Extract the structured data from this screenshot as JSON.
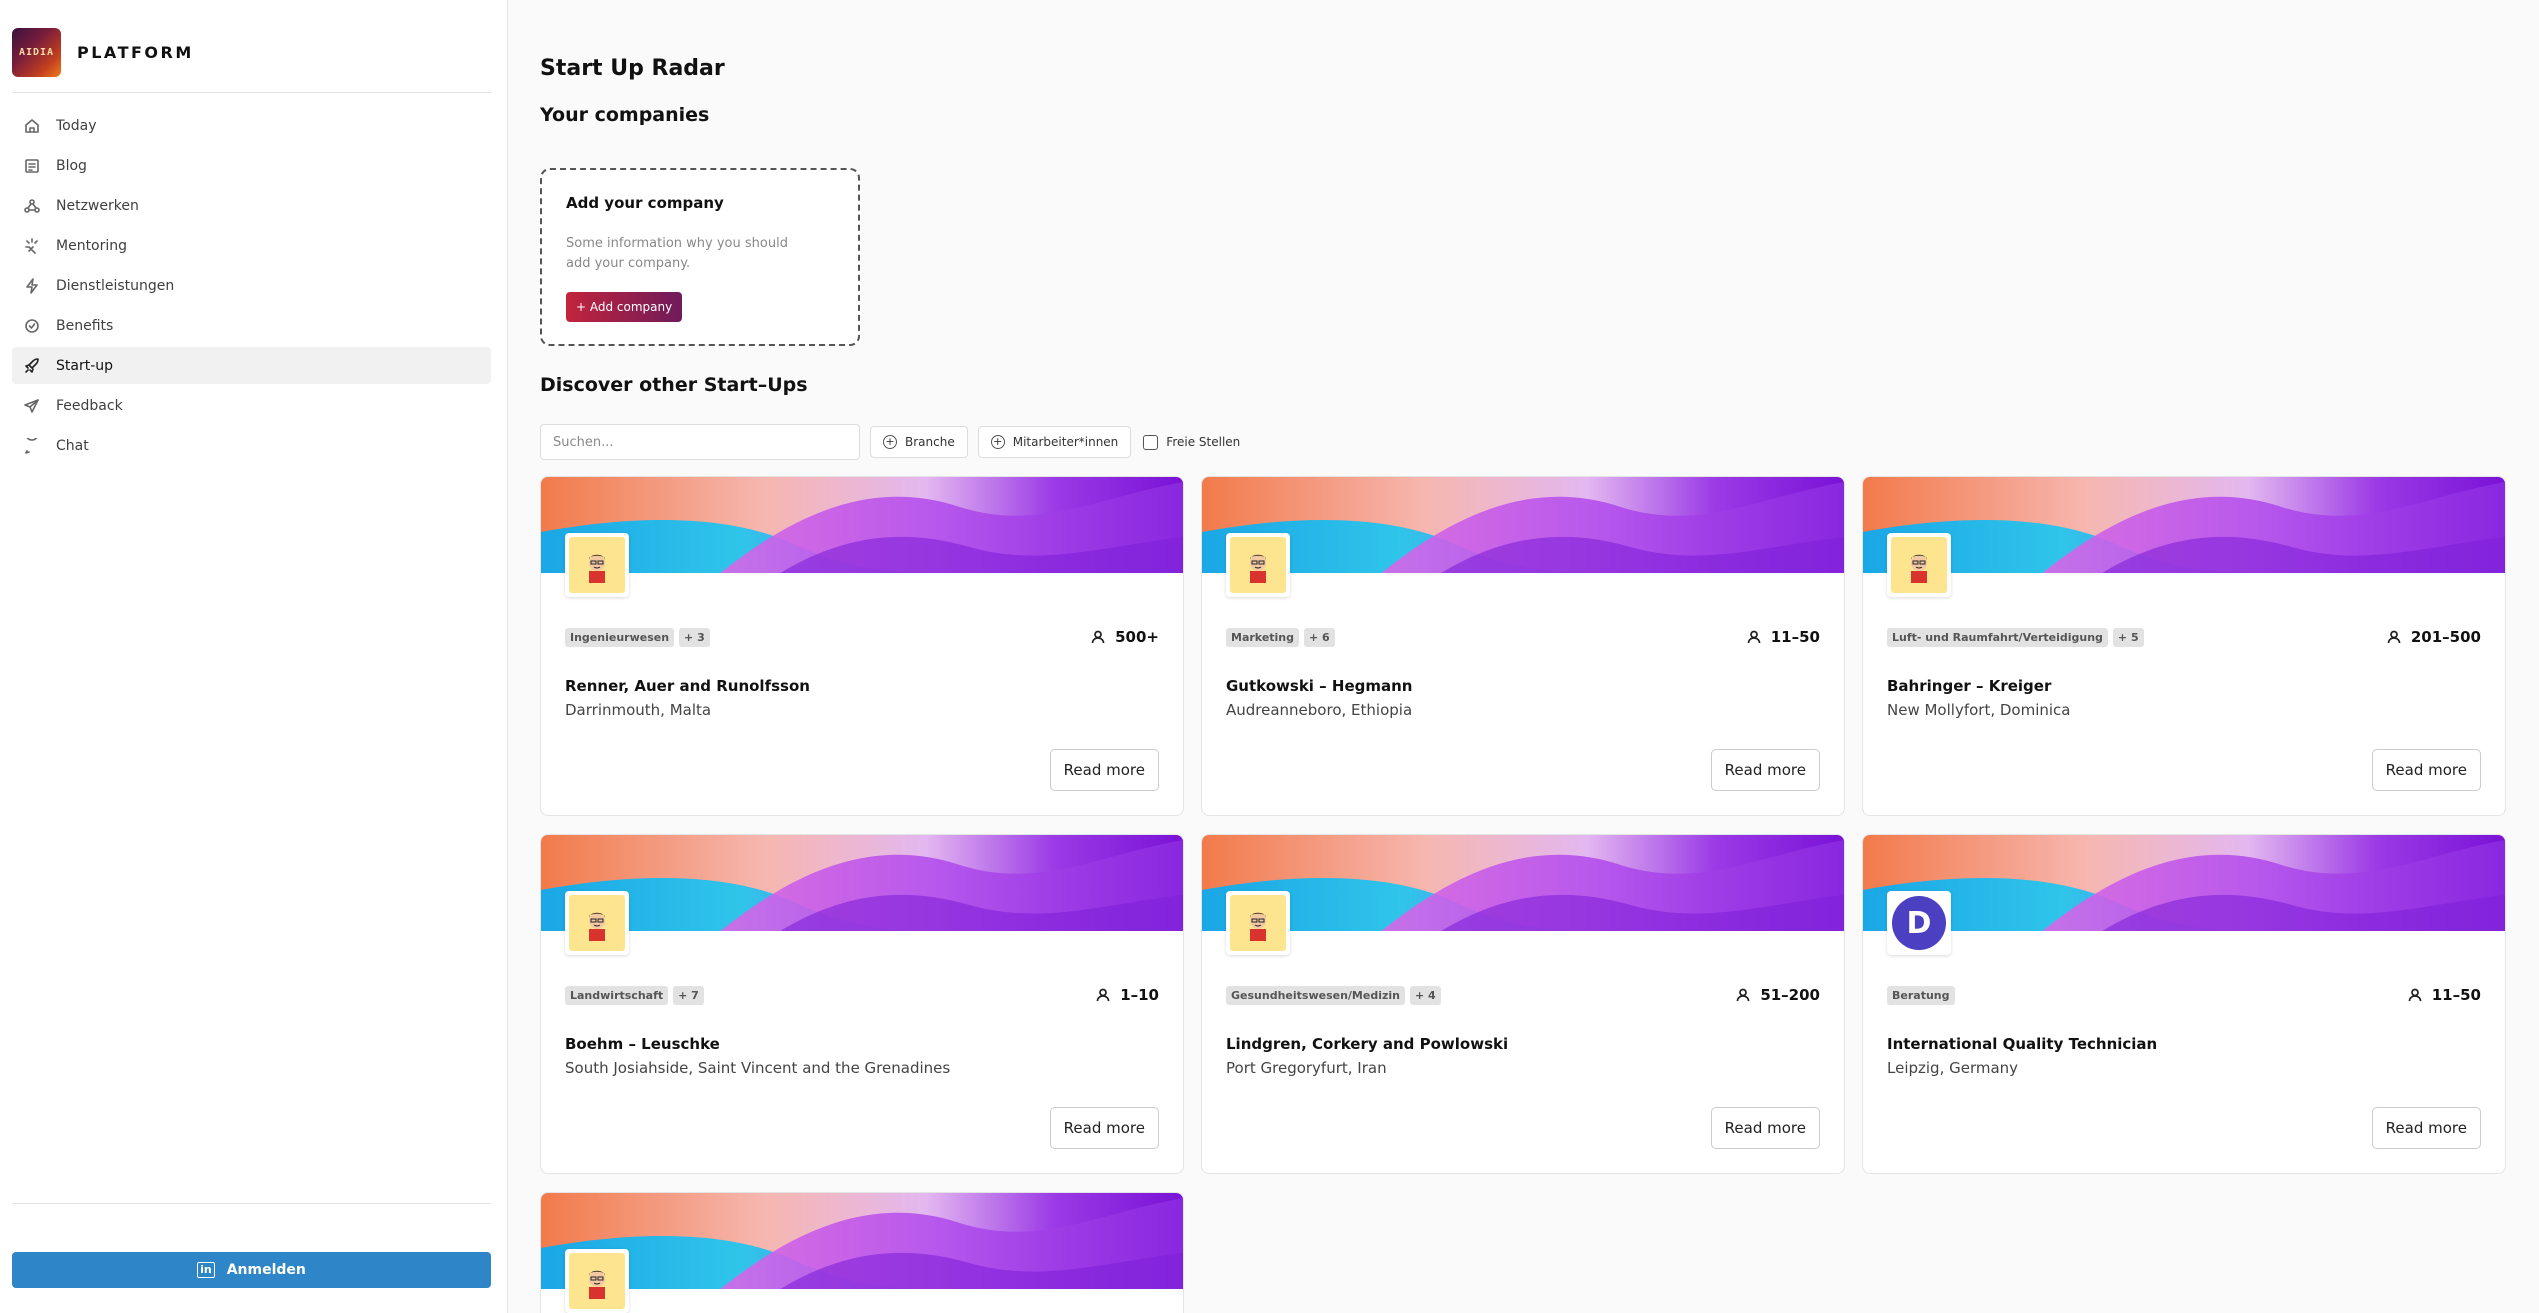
{
  "sidebar": {
    "brand": {
      "logo_text": "AIDIA",
      "name": "PLATFORM"
    },
    "nav": [
      {
        "label": "Today",
        "icon": "home-icon"
      },
      {
        "label": "Blog",
        "icon": "blog-icon"
      },
      {
        "label": "Netzwerken",
        "icon": "network-icon"
      },
      {
        "label": "Mentoring",
        "icon": "mentoring-icon"
      },
      {
        "label": "Dienstleistungen",
        "icon": "bolt-icon"
      },
      {
        "label": "Benefits",
        "icon": "badge-icon"
      },
      {
        "label": "Start-up",
        "icon": "rocket-icon",
        "active": true
      },
      {
        "label": "Feedback",
        "icon": "send-icon"
      },
      {
        "label": "Chat",
        "icon": "chat-icon"
      }
    ],
    "login_label": "Anmelden"
  },
  "main": {
    "title": "Start Up Radar",
    "your_companies": "Your companies",
    "add_card": {
      "title": "Add your company",
      "description": "Some information why you should add your company.",
      "button": "+ Add company"
    },
    "discover": "Discover other Start–Ups",
    "filters": {
      "search_placeholder": "Suchen...",
      "branche": "Branche",
      "mitarbeiter": "Mitarbeiter*innen",
      "freie_stellen": "Freie Stellen"
    },
    "read_more": "Read more",
    "companies": [
      {
        "tag": "Ingenieurwesen",
        "more": "+ 3",
        "employees": "500+",
        "name": "Renner, Auer and Runolfsson",
        "location": "Darrinmouth, Malta",
        "avatar": "cartoon"
      },
      {
        "tag": "Marketing",
        "more": "+ 6",
        "employees": "11–50",
        "name": "Gutkowski – Hegmann",
        "location": "Audreanneboro, Ethiopia",
        "avatar": "cartoon"
      },
      {
        "tag": "Luft- und Raumfahrt/Verteidigung",
        "more": "+ 5",
        "employees": "201–500",
        "name": "Bahringer – Kreiger",
        "location": "New Mollyfort, Dominica",
        "avatar": "cartoon"
      },
      {
        "tag": "Landwirtschaft",
        "more": "+ 7",
        "employees": "1–10",
        "name": "Boehm – Leuschke",
        "location": "South Josiahside, Saint Vincent and the Grenadines",
        "avatar": "cartoon"
      },
      {
        "tag": "Gesundheitswesen/Medizin",
        "more": "+ 4",
        "employees": "51–200",
        "name": "Lindgren, Corkery and Powlowski",
        "location": "Port Gregoryfurt, Iran",
        "avatar": "cartoon"
      },
      {
        "tag": "Beratung",
        "more": "",
        "employees": "11–50",
        "name": "International Quality Technician",
        "location": "Leipzig, Germany",
        "avatar": "letter",
        "avatar_letter": "D"
      }
    ]
  },
  "colors": {
    "login_button": "#2e85c8",
    "add_button_start": "#c2243c",
    "add_button_end": "#6f1b5b",
    "avatar_letter_bg": "#4b3fc2"
  }
}
